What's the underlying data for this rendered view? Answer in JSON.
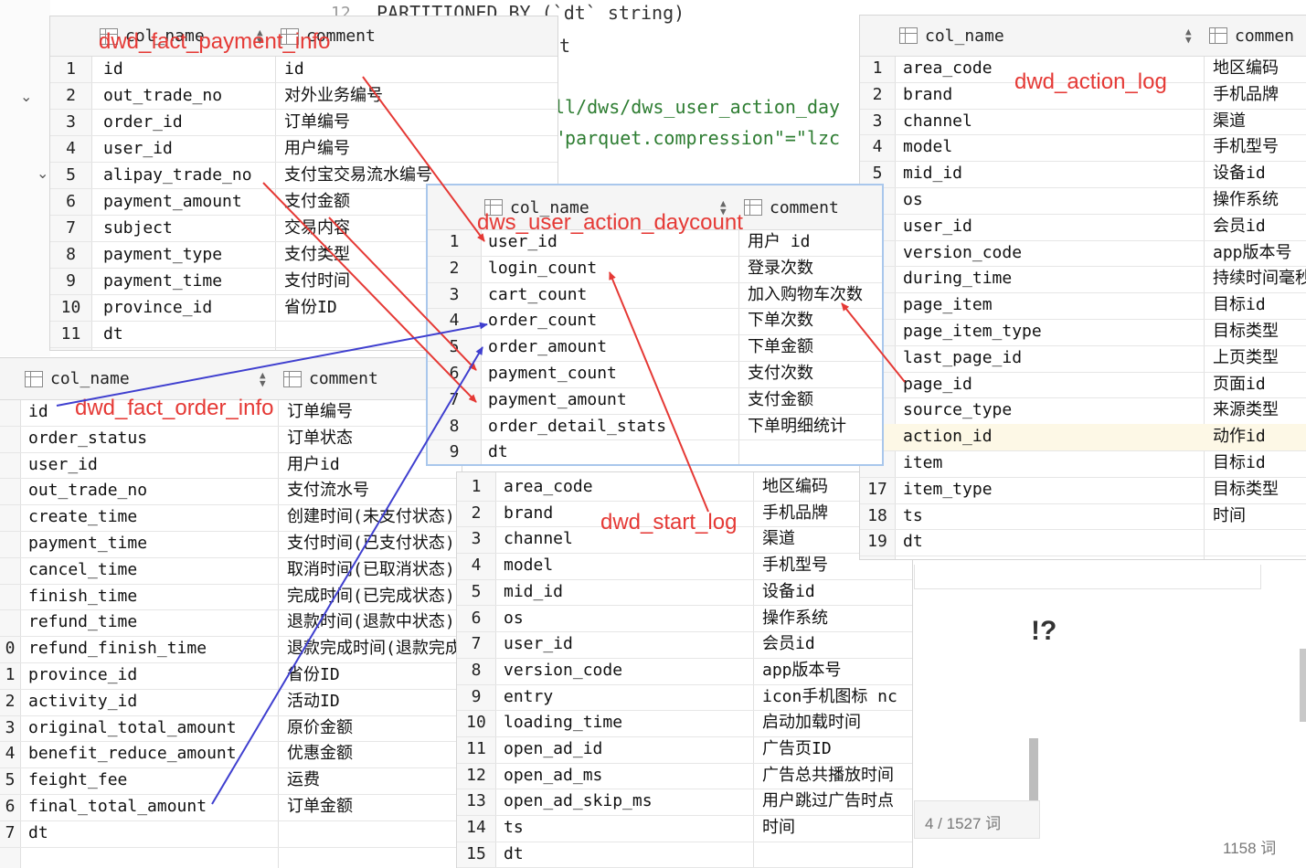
{
  "editor": {
    "lines": [
      {
        "num": "12",
        "text": "PARTITIONED BY (`dt` string)"
      },
      {
        "text": "et"
      },
      {
        "text": "ll/dws/dws_user_action_day"
      },
      {
        "text": "\"parquet.compression\"=\"lzc"
      }
    ]
  },
  "doc": {
    "question": "!?",
    "page_words": "4 / 1527 词",
    "total_words": "1158 词"
  },
  "headers": {
    "col_name": "col_name",
    "comment": "comment"
  },
  "tables": {
    "payment_info": {
      "label": "dwd_fact_payment_info",
      "rows": [
        {
          "n": "1",
          "name": "id",
          "comment": "id"
        },
        {
          "n": "2",
          "name": "out_trade_no",
          "comment": "对外业务编号"
        },
        {
          "n": "3",
          "name": "order_id",
          "comment": "订单编号"
        },
        {
          "n": "4",
          "name": "user_id",
          "comment": "用户编号"
        },
        {
          "n": "5",
          "name": "alipay_trade_no",
          "comment": "支付宝交易流水编号"
        },
        {
          "n": "6",
          "name": "payment_amount",
          "comment": "支付金额"
        },
        {
          "n": "7",
          "name": "subject",
          "comment": "交易内容"
        },
        {
          "n": "8",
          "name": "payment_type",
          "comment": "支付类型"
        },
        {
          "n": "9",
          "name": "payment_time",
          "comment": "支付时间"
        },
        {
          "n": "10",
          "name": "province_id",
          "comment": "省份ID"
        },
        {
          "n": "11",
          "name": "dt",
          "comment": ""
        }
      ]
    },
    "order_info": {
      "label": "dwd_fact_order_info",
      "rows": [
        {
          "n": "",
          "name": "id",
          "comment": "订单编号"
        },
        {
          "n": "",
          "name": "order_status",
          "comment": "订单状态"
        },
        {
          "n": "",
          "name": "user_id",
          "comment": "用户id"
        },
        {
          "n": "",
          "name": "out_trade_no",
          "comment": "支付流水号"
        },
        {
          "n": "",
          "name": "create_time",
          "comment": "创建时间(未支付状态)"
        },
        {
          "n": "",
          "name": "payment_time",
          "comment": "支付时间(已支付状态)"
        },
        {
          "n": "",
          "name": "cancel_time",
          "comment": "取消时间(已取消状态)"
        },
        {
          "n": "",
          "name": "finish_time",
          "comment": "完成时间(已完成状态)"
        },
        {
          "n": "",
          "name": "refund_time",
          "comment": "退款时间(退款中状态)"
        },
        {
          "n": "0",
          "name": "refund_finish_time",
          "comment": "退款完成时间(退款完成"
        },
        {
          "n": "1",
          "name": "province_id",
          "comment": "省份ID"
        },
        {
          "n": "2",
          "name": "activity_id",
          "comment": "活动ID"
        },
        {
          "n": "3",
          "name": "original_total_amount",
          "comment": "原价金额"
        },
        {
          "n": "4",
          "name": "benefit_reduce_amount",
          "comment": "优惠金额"
        },
        {
          "n": "5",
          "name": "feight_fee",
          "comment": "运费"
        },
        {
          "n": "6",
          "name": "final_total_amount",
          "comment": "订单金额"
        },
        {
          "n": "7",
          "name": "dt",
          "comment": ""
        }
      ]
    },
    "daycount": {
      "label": "dws_user_action_daycount",
      "rows": [
        {
          "n": "1",
          "name": "user_id",
          "comment": "用户 id"
        },
        {
          "n": "2",
          "name": "login_count",
          "comment": "登录次数"
        },
        {
          "n": "3",
          "name": "cart_count",
          "comment": "加入购物车次数"
        },
        {
          "n": "4",
          "name": "order_count",
          "comment": "下单次数"
        },
        {
          "n": "5",
          "name": "order_amount",
          "comment": "下单金额"
        },
        {
          "n": "6",
          "name": "payment_count",
          "comment": "支付次数"
        },
        {
          "n": "7",
          "name": "payment_amount",
          "comment": "支付金额"
        },
        {
          "n": "8",
          "name": "order_detail_stats",
          "comment": "下单明细统计"
        },
        {
          "n": "9",
          "name": "dt",
          "comment": ""
        }
      ]
    },
    "start_log": {
      "label": "dwd_start_log",
      "rows": [
        {
          "n": "1",
          "name": "area_code",
          "comment": "地区编码"
        },
        {
          "n": "2",
          "name": "brand",
          "comment": "手机品牌"
        },
        {
          "n": "3",
          "name": "channel",
          "comment": "渠道"
        },
        {
          "n": "4",
          "name": "model",
          "comment": "手机型号"
        },
        {
          "n": "5",
          "name": "mid_id",
          "comment": "设备id"
        },
        {
          "n": "6",
          "name": "os",
          "comment": "操作系统"
        },
        {
          "n": "7",
          "name": "user_id",
          "comment": "会员id"
        },
        {
          "n": "8",
          "name": "version_code",
          "comment": "app版本号"
        },
        {
          "n": "9",
          "name": "entry",
          "comment": " icon手机图标  nc"
        },
        {
          "n": "10",
          "name": "loading_time",
          "comment": "启动加载时间"
        },
        {
          "n": "11",
          "name": "open_ad_id",
          "comment": "广告页ID"
        },
        {
          "n": "12",
          "name": "open_ad_ms",
          "comment": "广告总共播放时间"
        },
        {
          "n": "13",
          "name": "open_ad_skip_ms",
          "comment": "用户跳过广告时点"
        },
        {
          "n": "14",
          "name": "ts",
          "comment": "时间"
        },
        {
          "n": "15",
          "name": "dt",
          "comment": ""
        }
      ]
    },
    "action_log": {
      "label": "dwd_action_log",
      "header_comment": "commen",
      "rows": [
        {
          "n": "1",
          "name": "area_code",
          "comment": "地区编码"
        },
        {
          "n": "2",
          "name": "brand",
          "comment": "手机品牌"
        },
        {
          "n": "3",
          "name": "channel",
          "comment": "渠道"
        },
        {
          "n": "4",
          "name": "model",
          "comment": "手机型号"
        },
        {
          "n": "5",
          "name": "mid_id",
          "comment": "设备id"
        },
        {
          "n": "",
          "name": "os",
          "comment": "操作系统"
        },
        {
          "n": "",
          "name": "user_id",
          "comment": "会员id"
        },
        {
          "n": "",
          "name": "version_code",
          "comment": "app版本号"
        },
        {
          "n": "",
          "name": "during_time",
          "comment": "持续时间毫秒"
        },
        {
          "n": "",
          "name": "page_item",
          "comment": "目标id"
        },
        {
          "n": "",
          "name": "page_item_type",
          "comment": "目标类型"
        },
        {
          "n": "",
          "name": "last_page_id",
          "comment": "上页类型"
        },
        {
          "n": "",
          "name": "page_id",
          "comment": "页面id"
        },
        {
          "n": "",
          "name": "source_type",
          "comment": "来源类型"
        },
        {
          "n": "",
          "name": "action_id",
          "comment": "动作id"
        },
        {
          "n": "",
          "name": "item",
          "comment": "目标id"
        },
        {
          "n": "17",
          "name": "item_type",
          "comment": "目标类型"
        },
        {
          "n": "18",
          "name": "ts",
          "comment": "时间"
        },
        {
          "n": "19",
          "name": "dt",
          "comment": ""
        }
      ]
    }
  },
  "colors": {
    "red_arrow": "#e53935",
    "blue_arrow": "#3f3fcf",
    "label": "#e53935"
  }
}
